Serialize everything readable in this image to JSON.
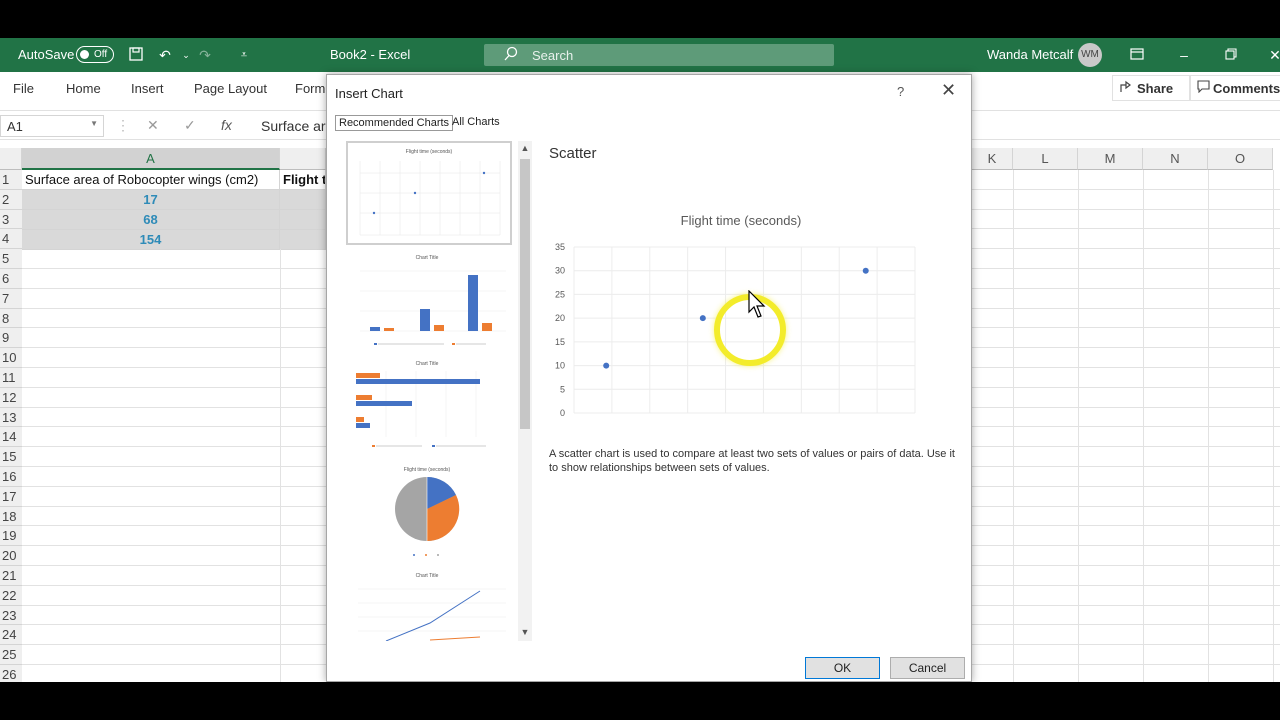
{
  "titlebar": {
    "autosave_label": "AutoSave",
    "autosave_state": "Off",
    "doc_title": "Book2  -  Excel",
    "search_placeholder": "Search",
    "user_name": "Wanda Metcalf",
    "user_initials": "WM",
    "bg_color": "#217346"
  },
  "ribbon": {
    "tabs": [
      "File",
      "Home",
      "Insert",
      "Page Layout",
      "Form"
    ],
    "share_label": "Share",
    "comments_label": "Comments"
  },
  "formula_bar": {
    "name_box": "A1",
    "fx": "fx",
    "content": "Surface are"
  },
  "sheet": {
    "columns": [
      "A",
      "K",
      "L",
      "M",
      "N",
      "O"
    ],
    "rows": [
      "1",
      "2",
      "3",
      "4",
      "5",
      "6",
      "7",
      "8",
      "9",
      "10",
      "11",
      "12",
      "13",
      "14",
      "15",
      "16",
      "17",
      "18",
      "19",
      "20",
      "21",
      "22",
      "23",
      "24",
      "25",
      "26"
    ],
    "a1": "Surface area of Robocopter wings (cm2)",
    "b1": "Flight ti",
    "a_values": [
      "17",
      "68",
      "154"
    ],
    "value_color": "#2e8bb8"
  },
  "dialog": {
    "title": "Insert Chart",
    "help": "?",
    "close": "✕",
    "tabs": [
      "Recommended Charts",
      "All Charts"
    ],
    "selected_type": "Scatter",
    "description": "A scatter chart is used to compare at least two sets of values or pairs of data. Use it to show relationships between sets of values.",
    "ok_label": "OK",
    "cancel_label": "Cancel",
    "thumbnails": [
      {
        "kind": "scatter",
        "title": "Flight time (seconds)"
      },
      {
        "kind": "column",
        "title": "Chart Title"
      },
      {
        "kind": "bar",
        "title": "Chart Title"
      },
      {
        "kind": "pie",
        "title": "Flight time (seconds)"
      },
      {
        "kind": "line",
        "title": "Chart Title"
      }
    ]
  },
  "chart_data": {
    "type": "scatter",
    "title": "Flight time (seconds)",
    "x": [
      17,
      68,
      154
    ],
    "y": [
      10,
      20,
      30
    ],
    "xlim": [
      0,
      180
    ],
    "ylim": [
      0,
      35
    ],
    "xticks": [
      0,
      20,
      40,
      60,
      80,
      100,
      120,
      140,
      160,
      180
    ],
    "yticks": [
      0,
      5,
      10,
      15,
      20,
      25,
      30,
      35
    ],
    "grid": true,
    "point_color": "#4472c4"
  }
}
